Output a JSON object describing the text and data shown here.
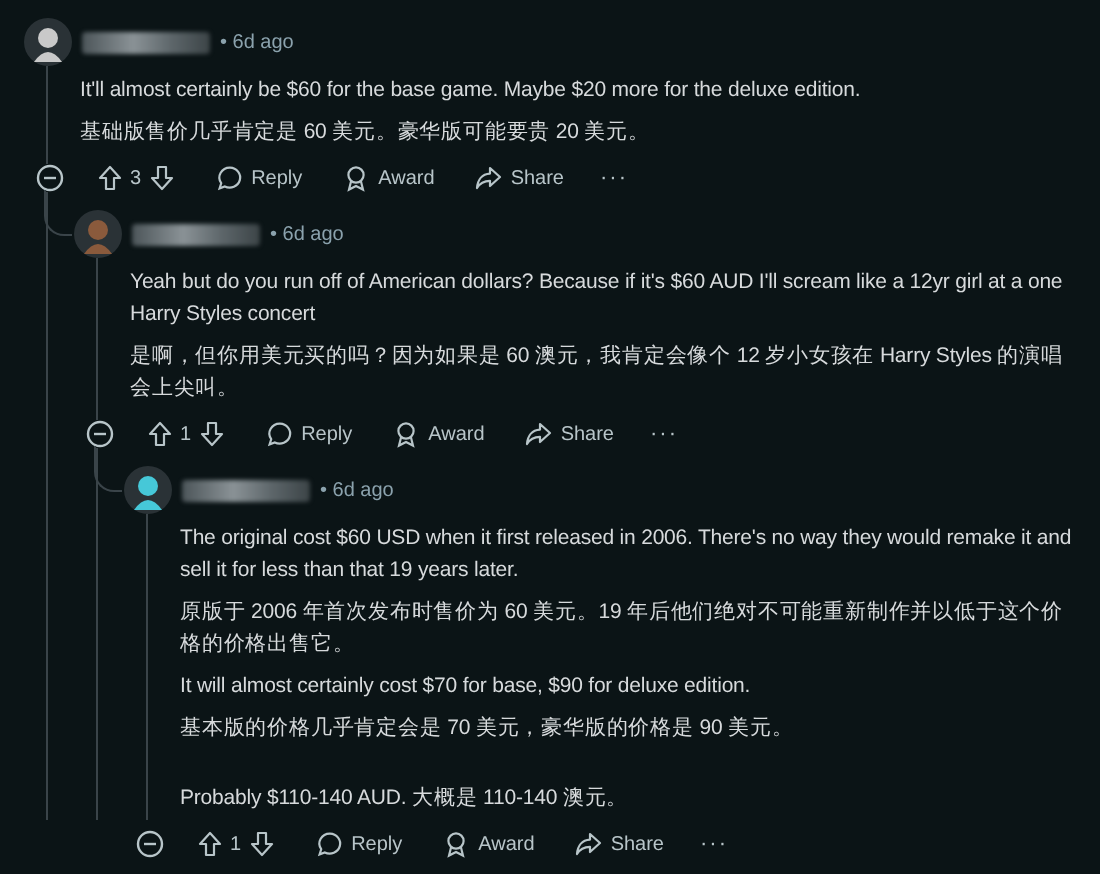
{
  "comments": [
    {
      "avatar": {
        "color": "#c9c9c9"
      },
      "time": "• 6d ago",
      "paragraphs": [
        {
          "text": "It'll almost certainly be $60 for the base game. Maybe $20 more for the deluxe edition.",
          "spaced": false
        },
        {
          "text": "基础版售价几乎肯定是 60 美元。豪华版可能要贵 20 美元。",
          "spaced": false
        }
      ],
      "votes": "3",
      "actions": [
        "Reply",
        "Award",
        "Share"
      ],
      "more": "···",
      "children": [
        {
          "avatar": {
            "color": "#8a5a3c"
          },
          "time": "• 6d ago",
          "paragraphs": [
            {
              "text": "Yeah but do you run off of American dollars? Because if it's $60 AUD I'll scream like a 12yr girl at a one Harry Styles concert",
              "spaced": false
            },
            {
              "text": "是啊，但你用美元买的吗？因为如果是 60 澳元，我肯定会像个 12 岁小女孩在 Harry Styles 的演唱会上尖叫。",
              "spaced": false
            }
          ],
          "votes": "1",
          "actions": [
            "Reply",
            "Award",
            "Share"
          ],
          "more": "···",
          "children": [
            {
              "avatar": {
                "color": "#46c8d8"
              },
              "time": "• 6d ago",
              "paragraphs": [
                {
                  "text": "The original cost $60 USD when it first released in 2006. There's no way they would remake it and sell it for less than that 19 years later.",
                  "spaced": false
                },
                {
                  "text": "原版于 2006 年首次发布时售价为 60 美元。19 年后他们绝对不可能重新制作并以低于这个价格的价格出售它。",
                  "spaced": false
                },
                {
                  "text": "It will almost certainly cost $70 for base, $90 for deluxe edition.",
                  "spaced": false
                },
                {
                  "text": "基本版的价格几乎肯定会是 70 美元，豪华版的价格是 90 美元。",
                  "spaced": false
                },
                {
                  "text": "Probably $110-140 AUD.  大概是 110-140 澳元。",
                  "spaced": true
                }
              ],
              "votes": "1",
              "actions": [
                "Reply",
                "Award",
                "Share"
              ],
              "more": "···"
            }
          ]
        }
      ]
    }
  ]
}
